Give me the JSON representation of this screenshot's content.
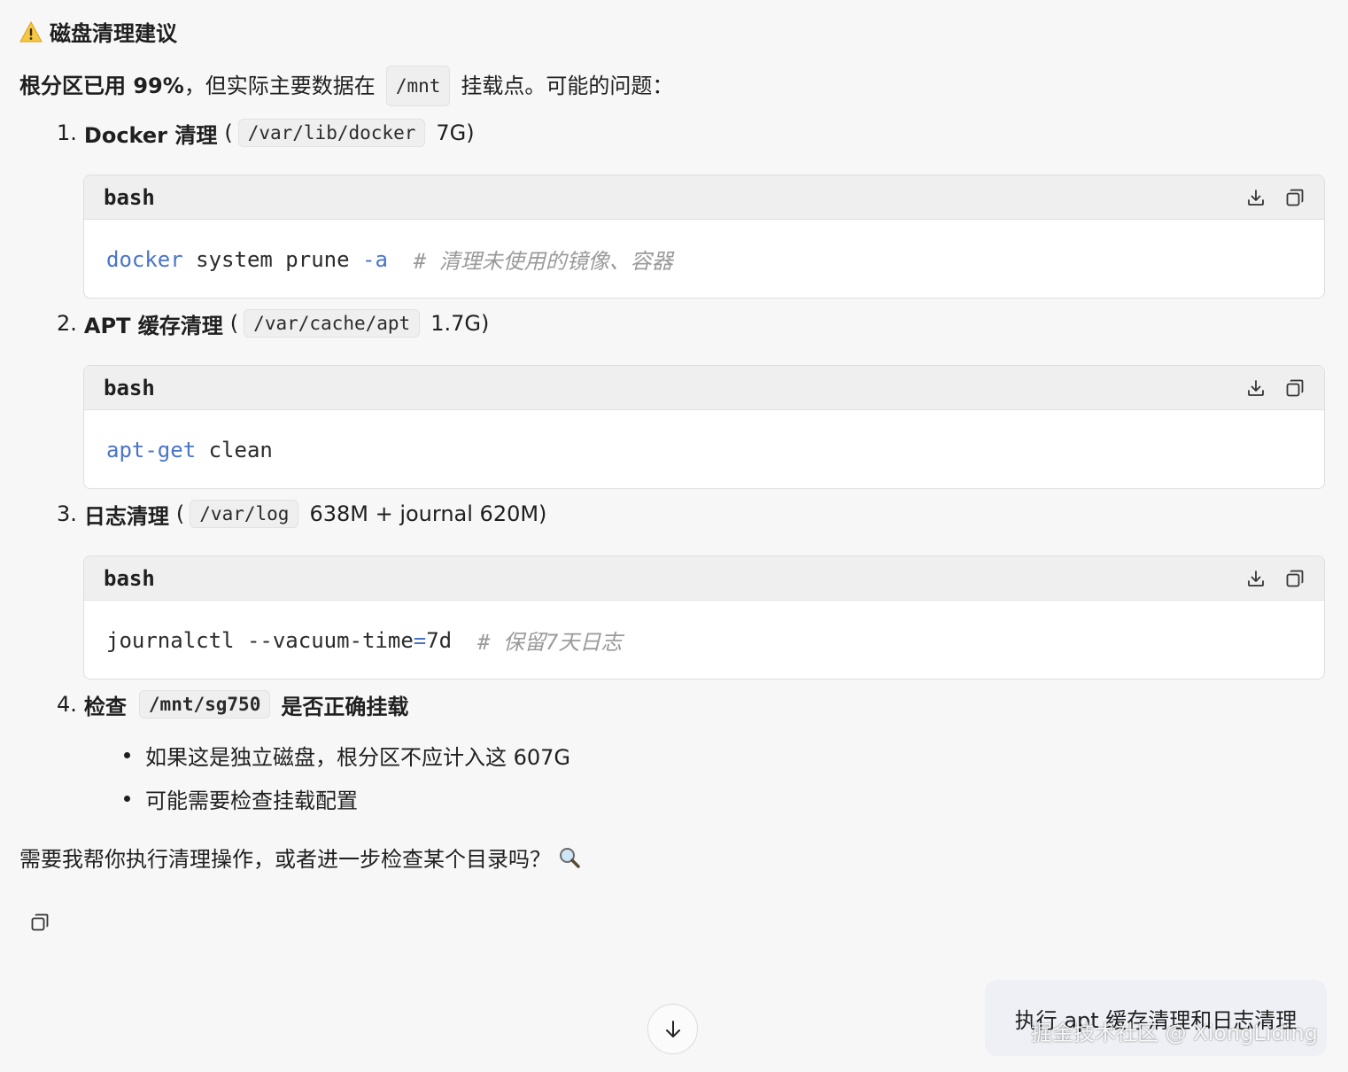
{
  "heading": {
    "icon": "warning-icon",
    "text": "磁盘清理建议"
  },
  "intro": {
    "bold": "根分区已用 99%",
    "text1": "，但实际主要数据在",
    "code": "/mnt",
    "text2": "挂载点。可能的问题："
  },
  "items": [
    {
      "num": "1.",
      "title": "Docker 清理",
      "open": "(",
      "path": "/var/lib/docker",
      "size": "7G)",
      "code": {
        "lang": "bash",
        "cmd": "docker",
        "rest": " system prune ",
        "opt": "-a",
        "comment": "  # 清理未使用的镜像、容器"
      }
    },
    {
      "num": "2.",
      "title": "APT 缓存清理",
      "open": "(",
      "path": "/var/cache/apt",
      "size": "1.7G)",
      "code": {
        "lang": "bash",
        "cmd": "apt-get",
        "rest": " clean"
      }
    },
    {
      "num": "3.",
      "title": "日志清理",
      "open": "(",
      "path": "/var/log",
      "size": "638M + journal 620M)",
      "code": {
        "lang": "bash",
        "pre": "journalctl --vacuum-time",
        "eq": "=",
        "post": "7d",
        "comment": "  # 保留7天日志"
      }
    },
    {
      "num": "4.",
      "title": "检查",
      "path": "/mnt/sg750",
      "title2": "是否正确挂载"
    }
  ],
  "bullets": [
    "如果这是独立磁盘，根分区不应计入这 607G",
    "可能需要检查挂载配置"
  ],
  "outro": {
    "text": "需要我帮你执行清理操作，或者进一步检查某个目录吗？",
    "icon": "magnifier-icon"
  },
  "suggestion": "执行 apt 缓存清理和日志清理",
  "watermark": "掘金技术社区 @ XiongLiding",
  "icons": {
    "download": "download-icon",
    "copy": "copy-icon",
    "scroll": "arrow-down-icon"
  }
}
